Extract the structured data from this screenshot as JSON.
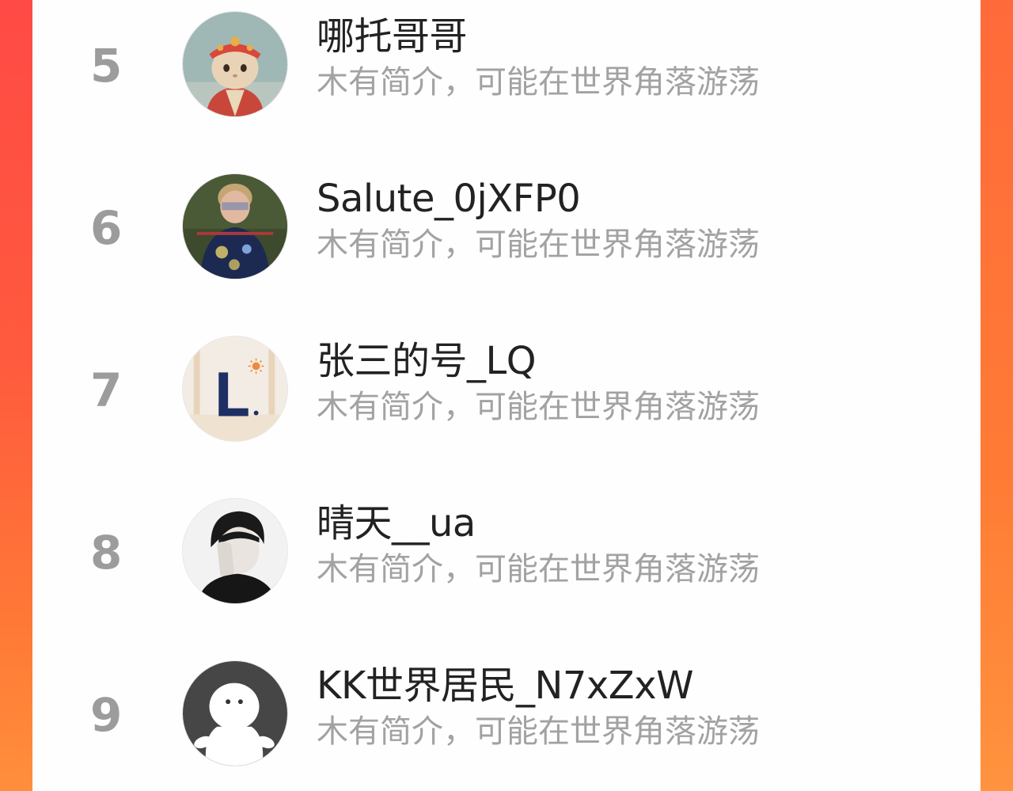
{
  "theme": {
    "accent": "#ff5a3e",
    "card_background": "#fefefe",
    "rank_color": "#9c9c9c",
    "name_color": "#222222",
    "bio_color": "#a2a2a2"
  },
  "ranking": {
    "rows": [
      {
        "rank": "5",
        "name": "哪托哥哥",
        "bio": "木有简介，可能在世界角落游荡",
        "avatar": "cat-monk-avatar"
      },
      {
        "rank": "6",
        "name": "Salute_0jXFP0",
        "bio": "木有简介，可能在世界角落游荡",
        "avatar": "child-photo-avatar"
      },
      {
        "rank": "7",
        "name": "张三的号_LQ",
        "bio": "木有简介，可能在世界角落游荡",
        "avatar": "letter-l-avatar"
      },
      {
        "rank": "8",
        "name": "晴天__ua",
        "bio": "木有简介，可能在世界角落游荡",
        "avatar": "person-photo-avatar"
      },
      {
        "rank": "9",
        "name": "KK世界居民_N7xZxW",
        "bio": "木有简介，可能在世界角落游荡",
        "avatar": "default-user-avatar"
      }
    ]
  }
}
